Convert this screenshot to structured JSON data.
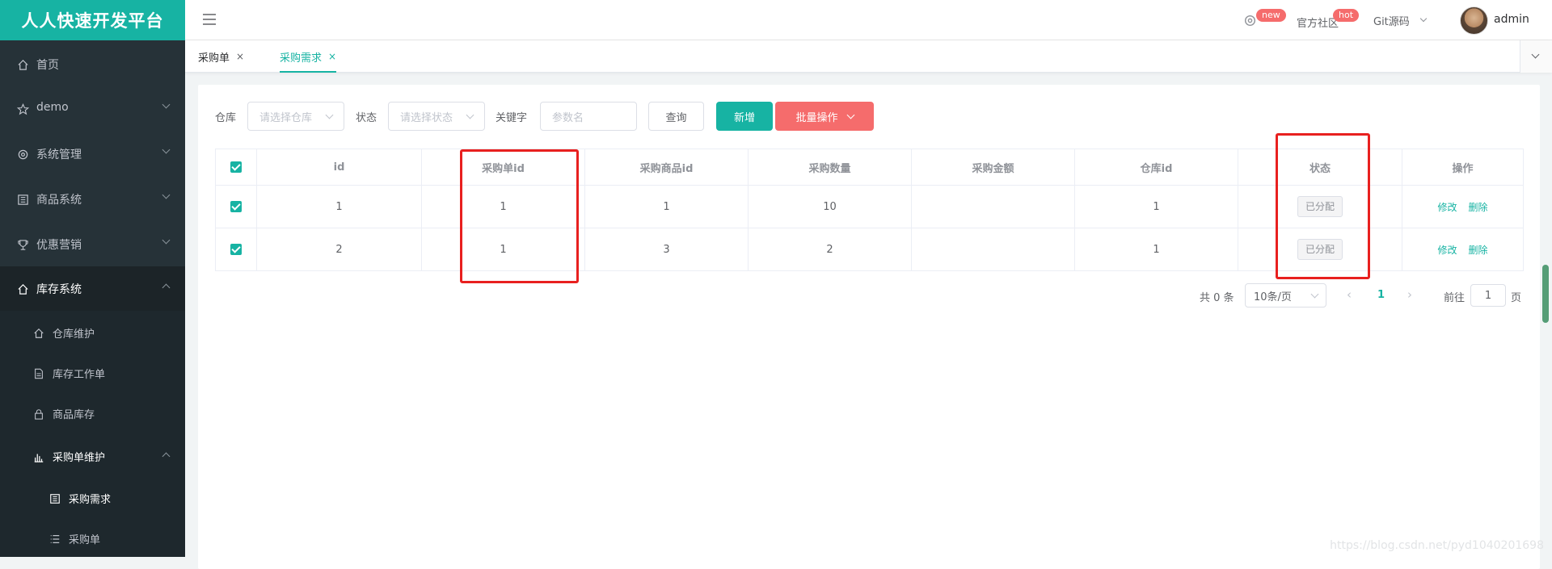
{
  "app": {
    "title": "人人快速开发平台"
  },
  "sidebar": {
    "items": [
      {
        "label": "首页",
        "icon": "home-icon"
      },
      {
        "label": "demo",
        "icon": "star-icon"
      },
      {
        "label": "系统管理",
        "icon": "gear-icon"
      },
      {
        "label": "商品系统",
        "icon": "grid-icon"
      },
      {
        "label": "优惠营销",
        "icon": "trophy-icon"
      },
      {
        "label": "库存系统",
        "icon": "home-icon"
      }
    ],
    "sub": [
      {
        "label": "仓库维护"
      },
      {
        "label": "库存工作单"
      },
      {
        "label": "商品库存"
      },
      {
        "label": "采购单维护"
      },
      {
        "label": "采购需求"
      },
      {
        "label": "采购单"
      }
    ]
  },
  "header": {
    "badge_new": "new",
    "badge_hot": "hot",
    "community": "官方社区",
    "git": "Git源码",
    "user": "admin"
  },
  "tabs": [
    {
      "label": "采购单",
      "close": "×"
    },
    {
      "label": "采购需求",
      "close": "×"
    }
  ],
  "filters": {
    "warehouse_label": "仓库",
    "warehouse_placeholder": "请选择仓库",
    "status_label": "状态",
    "status_placeholder": "请选择状态",
    "keyword_label": "关键字",
    "keyword_placeholder": "参数名",
    "query_btn": "查询",
    "add_btn": "新增",
    "batch_btn": "批量操作"
  },
  "table": {
    "headers": [
      "id",
      "采购单id",
      "采购商品id",
      "采购数量",
      "采购金额",
      "仓库id",
      "状态",
      "操作"
    ],
    "rows": [
      {
        "id": "1",
        "purchase_id": "1",
        "sku_id": "1",
        "num": "10",
        "amount": "",
        "ware_id": "1",
        "status": "已分配",
        "edit": "修改",
        "del": "删除"
      },
      {
        "id": "2",
        "purchase_id": "1",
        "sku_id": "3",
        "num": "2",
        "amount": "",
        "ware_id": "1",
        "status": "已分配",
        "edit": "修改",
        "del": "删除"
      }
    ]
  },
  "pagination": {
    "total": "共 0 条",
    "page_size": "10条/页",
    "current": "1",
    "goto_label": "前往",
    "goto_value": "1",
    "page_suffix": "页"
  },
  "watermark": "https://blog.csdn.net/pyd1040201698",
  "colors": {
    "accent": "#17b3a3",
    "danger": "#f56c6c",
    "sidebar": "#263238",
    "highlight_box": "#e8201f"
  }
}
